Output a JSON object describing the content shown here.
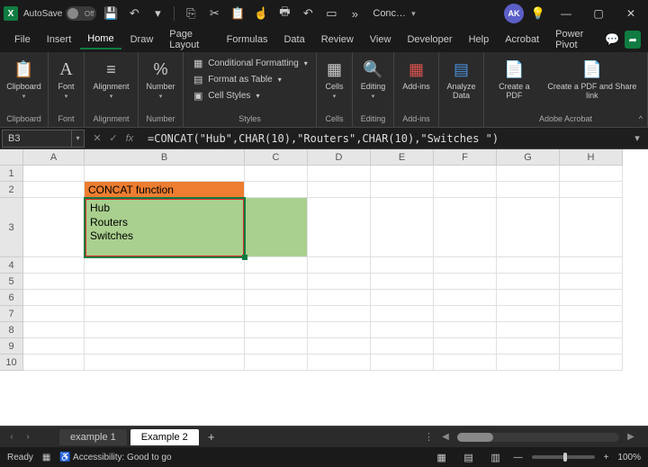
{
  "titlebar": {
    "autosave_label": "AutoSave",
    "autosave_state": "Off",
    "doc_name": "Conc…"
  },
  "avatar": "AK",
  "menu": [
    "File",
    "Insert",
    "Home",
    "Draw",
    "Page Layout",
    "Formulas",
    "Data",
    "Review",
    "View",
    "Developer",
    "Help",
    "Acrobat",
    "Power Pivot"
  ],
  "menu_active": 2,
  "ribbon": {
    "clipboard": "Clipboard",
    "font": "Font",
    "alignment": "Alignment",
    "number": "Number",
    "styles": "Styles",
    "cond_fmt": "Conditional Formatting",
    "fmt_table": "Format as Table",
    "cell_styles": "Cell Styles",
    "cells": "Cells",
    "editing": "Editing",
    "addins": "Add-ins",
    "addins_label": "Add-ins",
    "analyze": "Analyze Data",
    "create_pdf": "Create a PDF",
    "create_share": "Create a PDF and Share link",
    "adobe": "Adobe Acrobat"
  },
  "name_box": "B3",
  "formula": "=CONCAT(\"Hub\",CHAR(10),\"Routers\",CHAR(10),\"Switches \")",
  "columns": [
    "A",
    "B",
    "C",
    "D",
    "E",
    "F",
    "G",
    "H"
  ],
  "rows": [
    "1",
    "2",
    "3",
    "4",
    "5",
    "6",
    "7",
    "8",
    "9",
    "10"
  ],
  "cells": {
    "b2": "CONCAT function",
    "b3": "Hub\nRouters\nSwitches"
  },
  "tabs": {
    "t1": "example 1",
    "t2": "Example 2"
  },
  "status": {
    "ready": "Ready",
    "acc": "Accessibility: Good to go",
    "zoom": "100%"
  }
}
